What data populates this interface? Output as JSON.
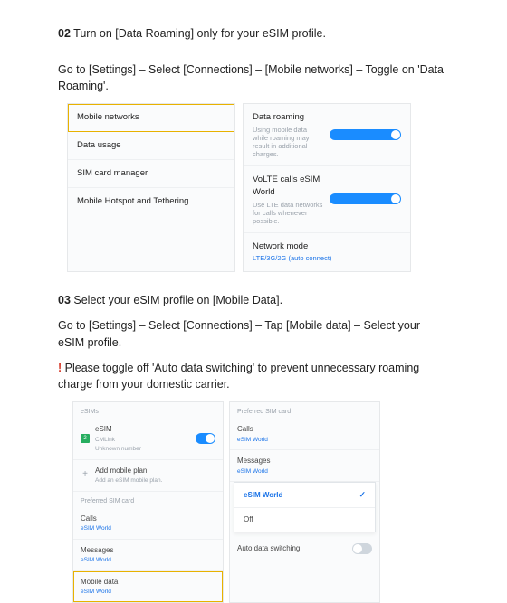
{
  "step02": {
    "num": "02",
    "title": " Turn on [Data Roaming] only for your eSIM profile.",
    "instr": "Go to [Settings] – Select [Connections] – [Mobile networks] – Toggle on 'Data Roaming'."
  },
  "fig1_left": [
    {
      "t": "Mobile networks"
    },
    {
      "t": "Data usage"
    },
    {
      "t": "SIM card manager"
    },
    {
      "t": "Mobile Hotspot and Tethering"
    }
  ],
  "fig1_right": {
    "r1": {
      "t": "Data roaming",
      "s": "Using mobile data while roaming may result in additional charges."
    },
    "r2": {
      "t": "VoLTE calls eSIM World",
      "s": "Use LTE data networks for calls whenever possible."
    },
    "r3": {
      "t": "Network mode",
      "s": "LTE/3G/2G (auto connect)"
    }
  },
  "step03": {
    "num": "03",
    "title": " Select your eSIM profile on [Mobile Data].",
    "instr": "Go to [Settings] – Select [Connections] – Tap [Mobile data] – Select your eSIM profile.",
    "warn_mark": "!",
    "warn": " Please toggle off 'Auto data switching' to prevent unnecessary roaming charge from your domestic carrier."
  },
  "fig2_left": {
    "head": "eSIMs",
    "esim": {
      "badge": "2",
      "t": "eSIM",
      "s1": "CMLink",
      "s2": "Unknown number"
    },
    "add": {
      "t": "Add mobile plan",
      "s": "Add an eSIM mobile plan."
    },
    "sec": "Preferred SIM card",
    "calls": {
      "t": "Calls",
      "s": "eSIM World"
    },
    "msgs": {
      "t": "Messages",
      "s": "eSIM World"
    },
    "mdata": {
      "t": "Mobile data",
      "s": "eSIM World"
    }
  },
  "fig2_right": {
    "sec": "Preferred SIM card",
    "calls": {
      "t": "Calls",
      "s": "eSIM World"
    },
    "msgs": {
      "t": "Messages",
      "s": "eSIM World"
    },
    "dropdown": {
      "sel": "eSIM World",
      "off": "Off"
    },
    "ads": "Auto data switching"
  }
}
